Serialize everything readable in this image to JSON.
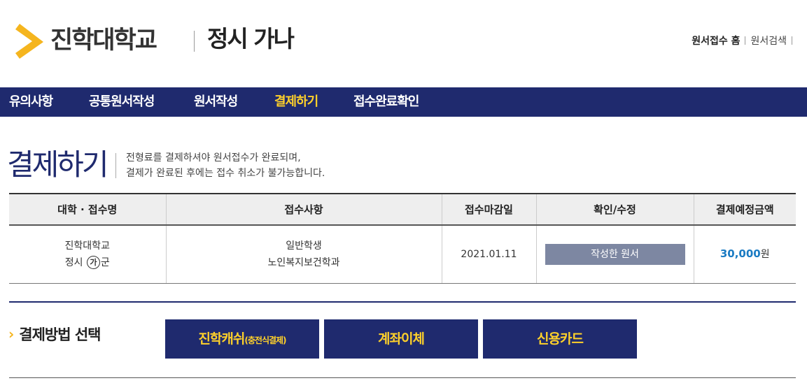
{
  "header": {
    "brand": "진학대학교",
    "service": "정시 가나",
    "util_home": "원서접수 홈",
    "util_search": "원서검색"
  },
  "nav": {
    "items": [
      "유의사항",
      "공통원서작성",
      "원서작성",
      "결제하기",
      "접수완료확인"
    ],
    "active_index": 3
  },
  "page": {
    "title": "결제하기",
    "desc_line1": "전형료를 결제하셔야 원서접수가 완료되며,",
    "desc_line2": "결제가 완료된 후에는 접수 취소가 불가능합니다."
  },
  "table": {
    "headers": [
      "대학 · 접수명",
      "접수사항",
      "접수마감일",
      "확인/수정",
      "결제예정금액"
    ],
    "row": {
      "univ_name": "진학대학교",
      "recruit_prefix": "정시",
      "recruit_group": "가",
      "recruit_suffix": "군",
      "applicant_type": "일반학생",
      "department": "노인복지보건학과",
      "deadline": "2021.01.11",
      "view_button": "작성한 원서",
      "amount": "30,000",
      "currency": "원"
    }
  },
  "payment": {
    "label": "결제방법 선택",
    "methods": [
      {
        "label": "진학캐쉬",
        "sub": "(충전식결제)"
      },
      {
        "label": "계좌이체",
        "sub": ""
      },
      {
        "label": "신용카드",
        "sub": ""
      }
    ]
  },
  "colors": {
    "navy": "#1f2a6e",
    "accent_yellow": "#ffd12a",
    "logo_yellow": "#f5b51e",
    "amount_blue": "#1a7bc3",
    "button_gray": "#7d87a2"
  },
  "icons": {
    "logo": "chevron-logo-icon",
    "pay_label": "chevron-right-icon"
  }
}
